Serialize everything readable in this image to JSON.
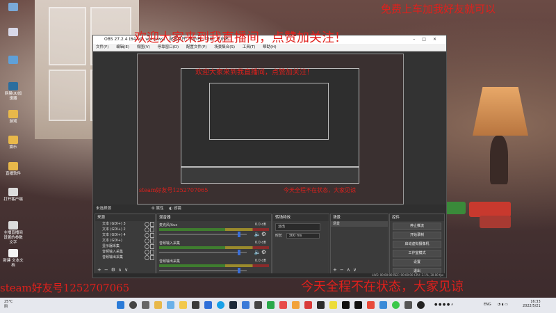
{
  "overlays": {
    "top_right": "免费上车加我好友就可以",
    "welcome": "欢迎大家来到我直播间，点赞加关注！",
    "steam_id": "steam好友号1252707065",
    "bottom_right": "今天全程不在状态，大家见谅",
    "nested_welcome": "欢迎大家来到我直播间，点赞加关注！",
    "nested_steam": "steam好友号1252707065",
    "nested_bottom": "今天全程不在状态，大家见谅"
  },
  "desktop_icons": [
    {
      "label": ""
    },
    {
      "label": ""
    },
    {
      "label": ""
    },
    {
      "label": "网易UU加速器"
    },
    {
      "label": "游戏"
    },
    {
      "label": "娱乐"
    },
    {
      "label": "直播软件"
    },
    {
      "label": "打开客户端"
    },
    {
      "label": "主播直播间设置的参数文字"
    },
    {
      "label": "新建 文本文档"
    }
  ],
  "obs": {
    "title": "OBS 27.2.4 (64-bit, windows) - 配置文件: 未命名 - 场景: 未命名",
    "menu": [
      "文件(F)",
      "编辑(E)",
      "视图(V)",
      "停靠窗口(D)",
      "配置文件(P)",
      "场景集合(S)",
      "工具(T)",
      "帮助(H)"
    ],
    "source_bar": {
      "label": "未选择源",
      "properties": "属性",
      "filters": "滤镜"
    },
    "scenes": {
      "title": "场景",
      "items": [
        "场景"
      ]
    },
    "sources": {
      "title": "来源",
      "items": [
        "文本 (GDI+) 3",
        "文本 (GDI+) 2",
        "文本 (GDI+) 4",
        "文本 (GDI+)",
        "显示器采集",
        "音频输入采集",
        "音频输出采集"
      ]
    },
    "mixer": {
      "title": "混音器",
      "channels": [
        {
          "name": "麦克风/Aux",
          "db": "0.0 dB",
          "level": 0.9
        },
        {
          "name": "音频输入采集",
          "db": "0.0 dB",
          "level": 0.9
        },
        {
          "name": "音频输出采集",
          "db": "0.0 dB",
          "level": 0.9
        }
      ]
    },
    "transitions": {
      "title": "转场特效",
      "type": "淡出",
      "duration_label": "时长",
      "duration": "300 ms"
    },
    "controls": {
      "title": "控件",
      "buttons": [
        "停止推流",
        "开始录制",
        "启动虚拟摄像机",
        "工作室模式",
        "设置",
        "退出"
      ]
    },
    "status": "LIVE: 00:00:00  REC: 00:00:00  CPU: 3.1%, 30.00 fps"
  },
  "taskbar": {
    "weather_temp": "25°C",
    "weather_desc": "阴",
    "lang": "ENG",
    "time": "16:33",
    "date": "2022/5/21"
  },
  "colors": {
    "overlay_red": "#e0201c",
    "obs_panel": "#3b3b3b",
    "meter_green": "#3f7d2f"
  }
}
